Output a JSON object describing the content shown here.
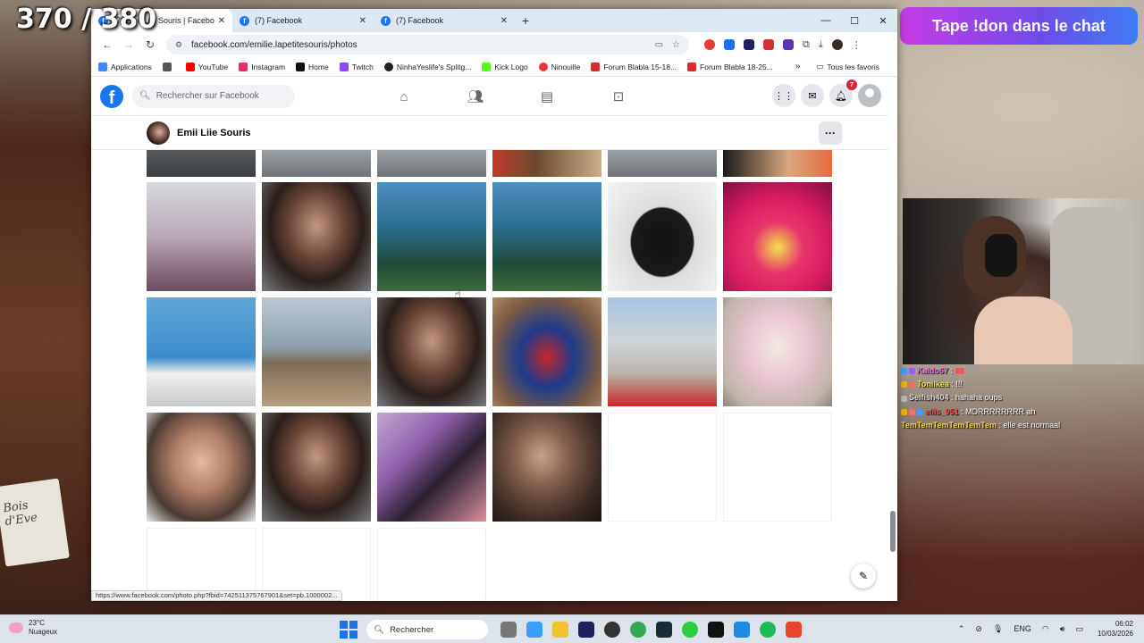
{
  "stream": {
    "counter": "370 / 380",
    "banner": "Tape !don dans le chat",
    "chat": [
      {
        "user": "Kaido67",
        "sep": " :",
        "msg": "",
        "ucolor": "u1"
      },
      {
        "user": "Tonilkea",
        "sep": " :",
        "msg": " !!!",
        "ucolor": "u2"
      },
      {
        "user": "Selfish404",
        "sep": " :",
        "msg": " hahaha oups",
        "ucolor": "u3"
      },
      {
        "user": "eliis_951",
        "sep": " :",
        "msg": " MDRRRRRRRR ah",
        "ucolor": "u4"
      },
      {
        "user": "TemTemTemTemTemTem",
        "sep": " :",
        "msg": " elle est normaal",
        "ucolor": "u5"
      }
    ]
  },
  "browser": {
    "tabs": [
      {
        "title": "(7) Emii Liie Souris | Facebook",
        "active": true
      },
      {
        "title": "(7) Facebook",
        "active": false
      },
      {
        "title": "(7) Facebook",
        "active": false
      }
    ],
    "url": "facebook.com/emilie.lapetitesouris/photos",
    "bookmarks": [
      {
        "label": "Applications",
        "color": "#4285f4"
      },
      {
        "label": "",
        "color": "#555555"
      },
      {
        "label": "YouTube",
        "color": "#ff0000"
      },
      {
        "label": "Instagram",
        "color": "#e1306c"
      },
      {
        "label": "Home",
        "color": "#111111"
      },
      {
        "label": "Twitch",
        "color": "#9146ff"
      },
      {
        "label": "NinhaYeslife's Splitg...",
        "color": "#222222"
      },
      {
        "label": "Kick Logo",
        "color": "#53fc18"
      },
      {
        "label": "Ninouille",
        "color": "#e53935"
      },
      {
        "label": "Forum Blabla 15-18...",
        "color": "#d32f2f"
      },
      {
        "label": "Forum Blabla 18-25...",
        "color": "#d32f2f"
      }
    ],
    "all_bookmarks": "Tous les favoris",
    "status_url": "https://www.facebook.com/photo.php?fbid=742511375767901&set=pb.1000002..."
  },
  "facebook": {
    "search_placeholder": "Rechercher sur Facebook",
    "notif_count": "7",
    "profile_name": "Emii Liie Souris",
    "accent": "#1877f2"
  },
  "taskbar": {
    "temp": "23°C",
    "weather": "Nuageux",
    "search": "Rechercher",
    "lang": "ENG",
    "time": "06:02",
    "date": "10/03/2026"
  }
}
